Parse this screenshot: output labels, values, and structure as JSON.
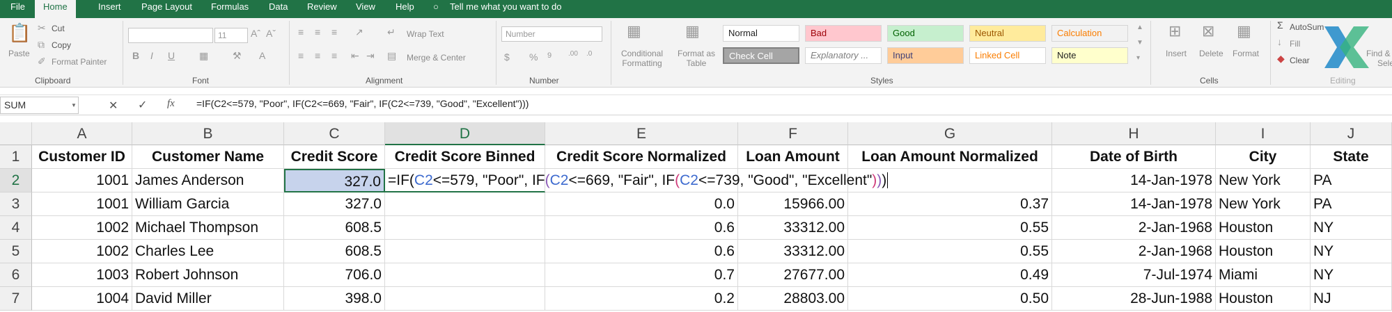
{
  "menu": {
    "tabs": [
      "File",
      "Home",
      "Insert",
      "Page Layout",
      "Formulas",
      "Data",
      "Review",
      "View",
      "Help"
    ],
    "active": "Home",
    "tell_me": "Tell me what you want to do"
  },
  "ribbon": {
    "clipboard": {
      "paste": "Paste",
      "cut": "Cut",
      "copy": "Copy",
      "format_painter": "Format Painter",
      "label": "Clipboard"
    },
    "font": {
      "size": "11",
      "label": "Font"
    },
    "alignment": {
      "wrap_text": "Wrap Text",
      "merge_center": "Merge & Center",
      "label": "Alignment"
    },
    "number": {
      "format": "Number",
      "label": "Number"
    },
    "styles": {
      "conditional_formatting": "Conditional Formatting",
      "format_as_table": "Format as Table",
      "cells": [
        {
          "label": "Normal",
          "bg": "#ffffff",
          "fg": "#222222"
        },
        {
          "label": "Bad",
          "bg": "#ffc7ce",
          "fg": "#9c0006"
        },
        {
          "label": "Good",
          "bg": "#c6efce",
          "fg": "#006100"
        },
        {
          "label": "Neutral",
          "bg": "#ffeb9c",
          "fg": "#9c5700"
        },
        {
          "label": "Calculation",
          "bg": "#f2f2f2",
          "fg": "#fa7d00"
        },
        {
          "label": "Check Cell",
          "bg": "#a5a5a5",
          "fg": "#ffffff"
        },
        {
          "label": "Explanatory ...",
          "bg": "#ffffff",
          "fg": "#7f7f7f"
        },
        {
          "label": "Input",
          "bg": "#ffcc99",
          "fg": "#3f3f76"
        },
        {
          "label": "Linked Cell",
          "bg": "#ffffff",
          "fg": "#fa7d00"
        },
        {
          "label": "Note",
          "bg": "#ffffcc",
          "fg": "#222222"
        }
      ],
      "label": "Styles"
    },
    "cells": {
      "insert": "Insert",
      "delete": "Delete",
      "format": "Format",
      "label": "Cells"
    },
    "editing": {
      "autosum": "AutoSum",
      "fill": "Fill",
      "clear": "Clear",
      "find": "Find &",
      "select": "Sele",
      "label": "Editing"
    }
  },
  "formula_bar": {
    "name_box": "SUM",
    "formula": "=IF(C2<=579, \"Poor\", IF(C2<=669, \"Fair\", IF(C2<=739, \"Good\", \"Excellent\")))"
  },
  "sheet": {
    "columns": [
      "A",
      "B",
      "C",
      "D",
      "E",
      "F",
      "G",
      "H",
      "I",
      "J"
    ],
    "selected_column": "D",
    "headers": [
      "Customer ID",
      "Customer Name",
      "Credit Score",
      "Credit Score Binned",
      "Credit Score Normalized",
      "Loan Amount",
      "Loan Amount Normalized",
      "Date of Birth",
      "City",
      "State"
    ],
    "rows": [
      {
        "num": "2",
        "cells": [
          "1001",
          "James Anderson",
          "327.0",
          "",
          "",
          "",
          "",
          "14-Jan-1978",
          "New York",
          "PA"
        ]
      },
      {
        "num": "3",
        "cells": [
          "1001",
          "William Garcia",
          "327.0",
          "",
          "0.0",
          "15966.00",
          "0.37",
          "14-Jan-1978",
          "New York",
          "PA"
        ]
      },
      {
        "num": "4",
        "cells": [
          "1002",
          "Michael Thompson",
          "608.5",
          "",
          "0.6",
          "33312.00",
          "0.55",
          "2-Jan-1968",
          "Houston",
          "NY"
        ]
      },
      {
        "num": "5",
        "cells": [
          "1002",
          "Charles Lee",
          "608.5",
          "",
          "0.6",
          "33312.00",
          "0.55",
          "2-Jan-1968",
          "Houston",
          "NY"
        ]
      },
      {
        "num": "6",
        "cells": [
          "1003",
          "Robert Johnson",
          "706.0",
          "",
          "0.7",
          "27677.00",
          "0.49",
          "7-Jul-1974",
          "Miami",
          "NY"
        ]
      },
      {
        "num": "7",
        "cells": [
          "1004",
          "David Miller",
          "398.0",
          "",
          "0.2",
          "28803.00",
          "0.50",
          "28-Jun-1988",
          "Houston",
          "NJ"
        ]
      }
    ],
    "header_row_num": "1",
    "edit_cell": {
      "parts": [
        {
          "t": "=IF(",
          "c": "txt"
        },
        {
          "t": "C2",
          "c": "ref"
        },
        {
          "t": "<=579, \"Poor\", IF",
          "c": "txt"
        },
        {
          "t": "(",
          "c": "par1"
        },
        {
          "t": "C2",
          "c": "ref"
        },
        {
          "t": "<=669, \"Fair\", IF",
          "c": "txt"
        },
        {
          "t": "(",
          "c": "par2"
        },
        {
          "t": "C2",
          "c": "ref"
        },
        {
          "t": "<=739, \"Good\", \"Excellent\"",
          "c": "txt"
        },
        {
          "t": ")",
          "c": "par2"
        },
        {
          "t": ")",
          "c": "par1"
        },
        {
          "t": ")",
          "c": "txt"
        }
      ]
    }
  },
  "colors": {
    "accent": "#217346",
    "selection": "#c7d3ec"
  }
}
